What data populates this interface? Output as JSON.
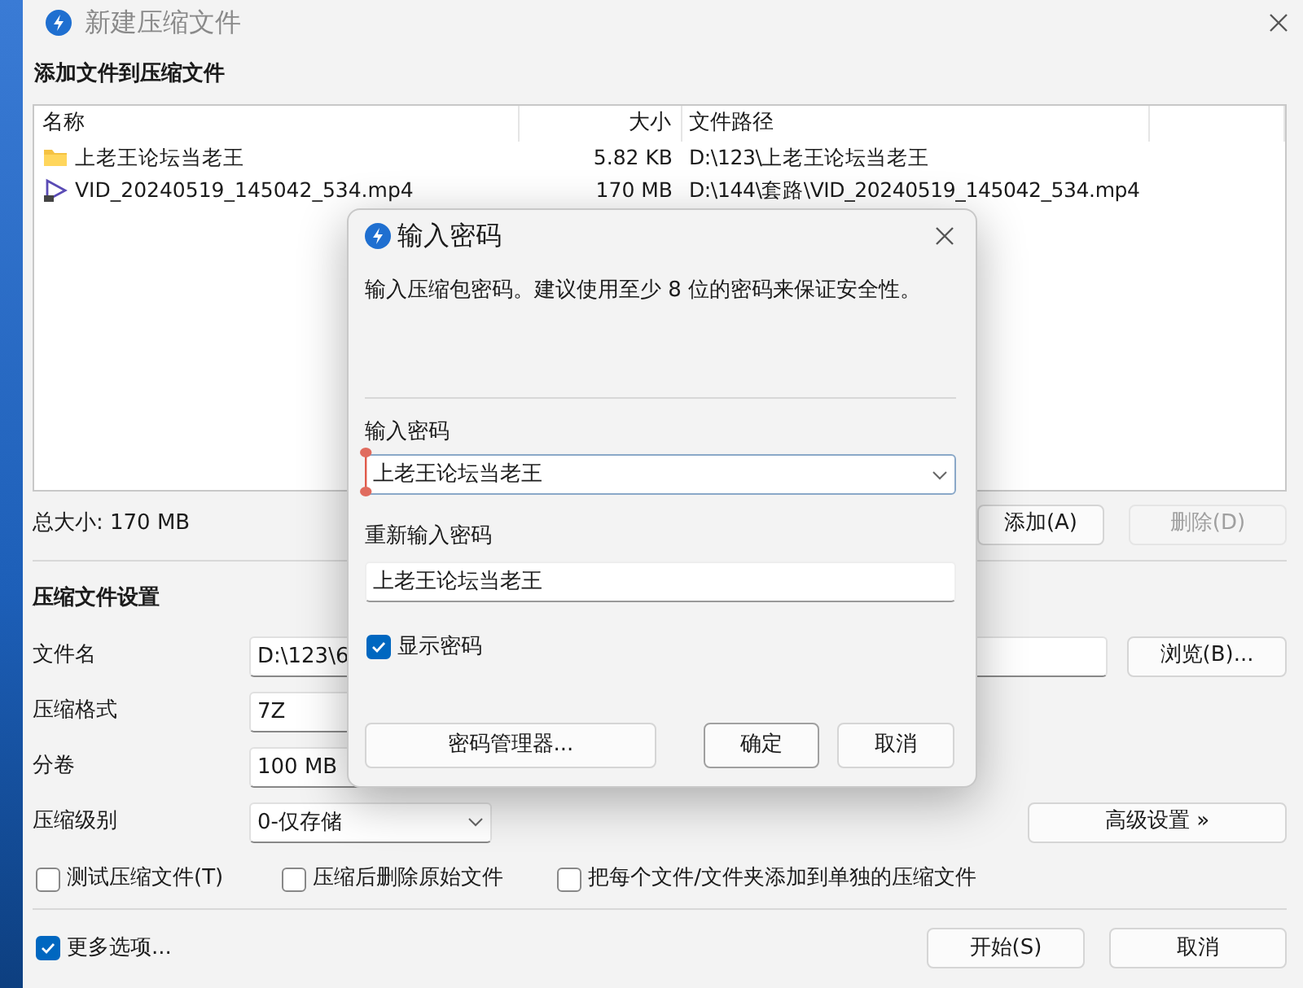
{
  "window": {
    "title": "新建压缩文件"
  },
  "files": {
    "heading": "添加文件到压缩文件",
    "columns": [
      "名称",
      "大小",
      "文件路径"
    ],
    "rows": [
      {
        "kind": "folder",
        "name": "上老王论坛当老王",
        "size": "5.82 KB",
        "path": "D:\\123\\上老王论坛当老王"
      },
      {
        "kind": "video",
        "name": "VID_20240519_145042_534.mp4",
        "size": "170 MB",
        "path": "D:\\144\\套路\\VID_20240519_145042_534.mp4"
      }
    ]
  },
  "total_size": "总大小: 170 MB",
  "list_buttons": [
    {
      "label": "添加(A)",
      "disabled": false
    },
    {
      "label": "删除(D)",
      "disabled": true
    }
  ],
  "settings": {
    "heading": "压缩文件设置",
    "fields": [
      {
        "kind": "text",
        "label": "文件名",
        "value": "D:\\123\\6"
      },
      {
        "kind": "text",
        "label": "压缩格式",
        "value": "7Z"
      },
      {
        "kind": "text",
        "label": "分卷",
        "value": "100 MB"
      },
      {
        "kind": "select",
        "label": "压缩级别",
        "value": "0-仅存储"
      }
    ],
    "browse_button": "浏览(B)...",
    "advanced_button": "高级设置 »"
  },
  "options": [
    {
      "label": "测试压缩文件(T)",
      "checked": false
    },
    {
      "label": "压缩后删除原始文件",
      "checked": false
    },
    {
      "label": "把每个文件/文件夹添加到单独的压缩文件",
      "checked": false
    }
  ],
  "more_options": {
    "label": "更多选项...",
    "checked": true
  },
  "footer_buttons": [
    "开始(S)",
    "取消"
  ],
  "dialog": {
    "title": "输入密码",
    "message": "输入压缩包密码。建议使用至少 8 位的密码来保证安全性。",
    "password_label": "输入密码",
    "password": "上老王论坛当老王",
    "confirm_label": "重新输入密码",
    "confirm": "上老王论坛当老王",
    "show_password": {
      "label": "显示密码",
      "checked": true
    },
    "buttons": [
      {
        "label": "密码管理器...",
        "default": false
      },
      {
        "label": "确定",
        "default": true
      },
      {
        "label": "取消",
        "default": false
      }
    ]
  }
}
